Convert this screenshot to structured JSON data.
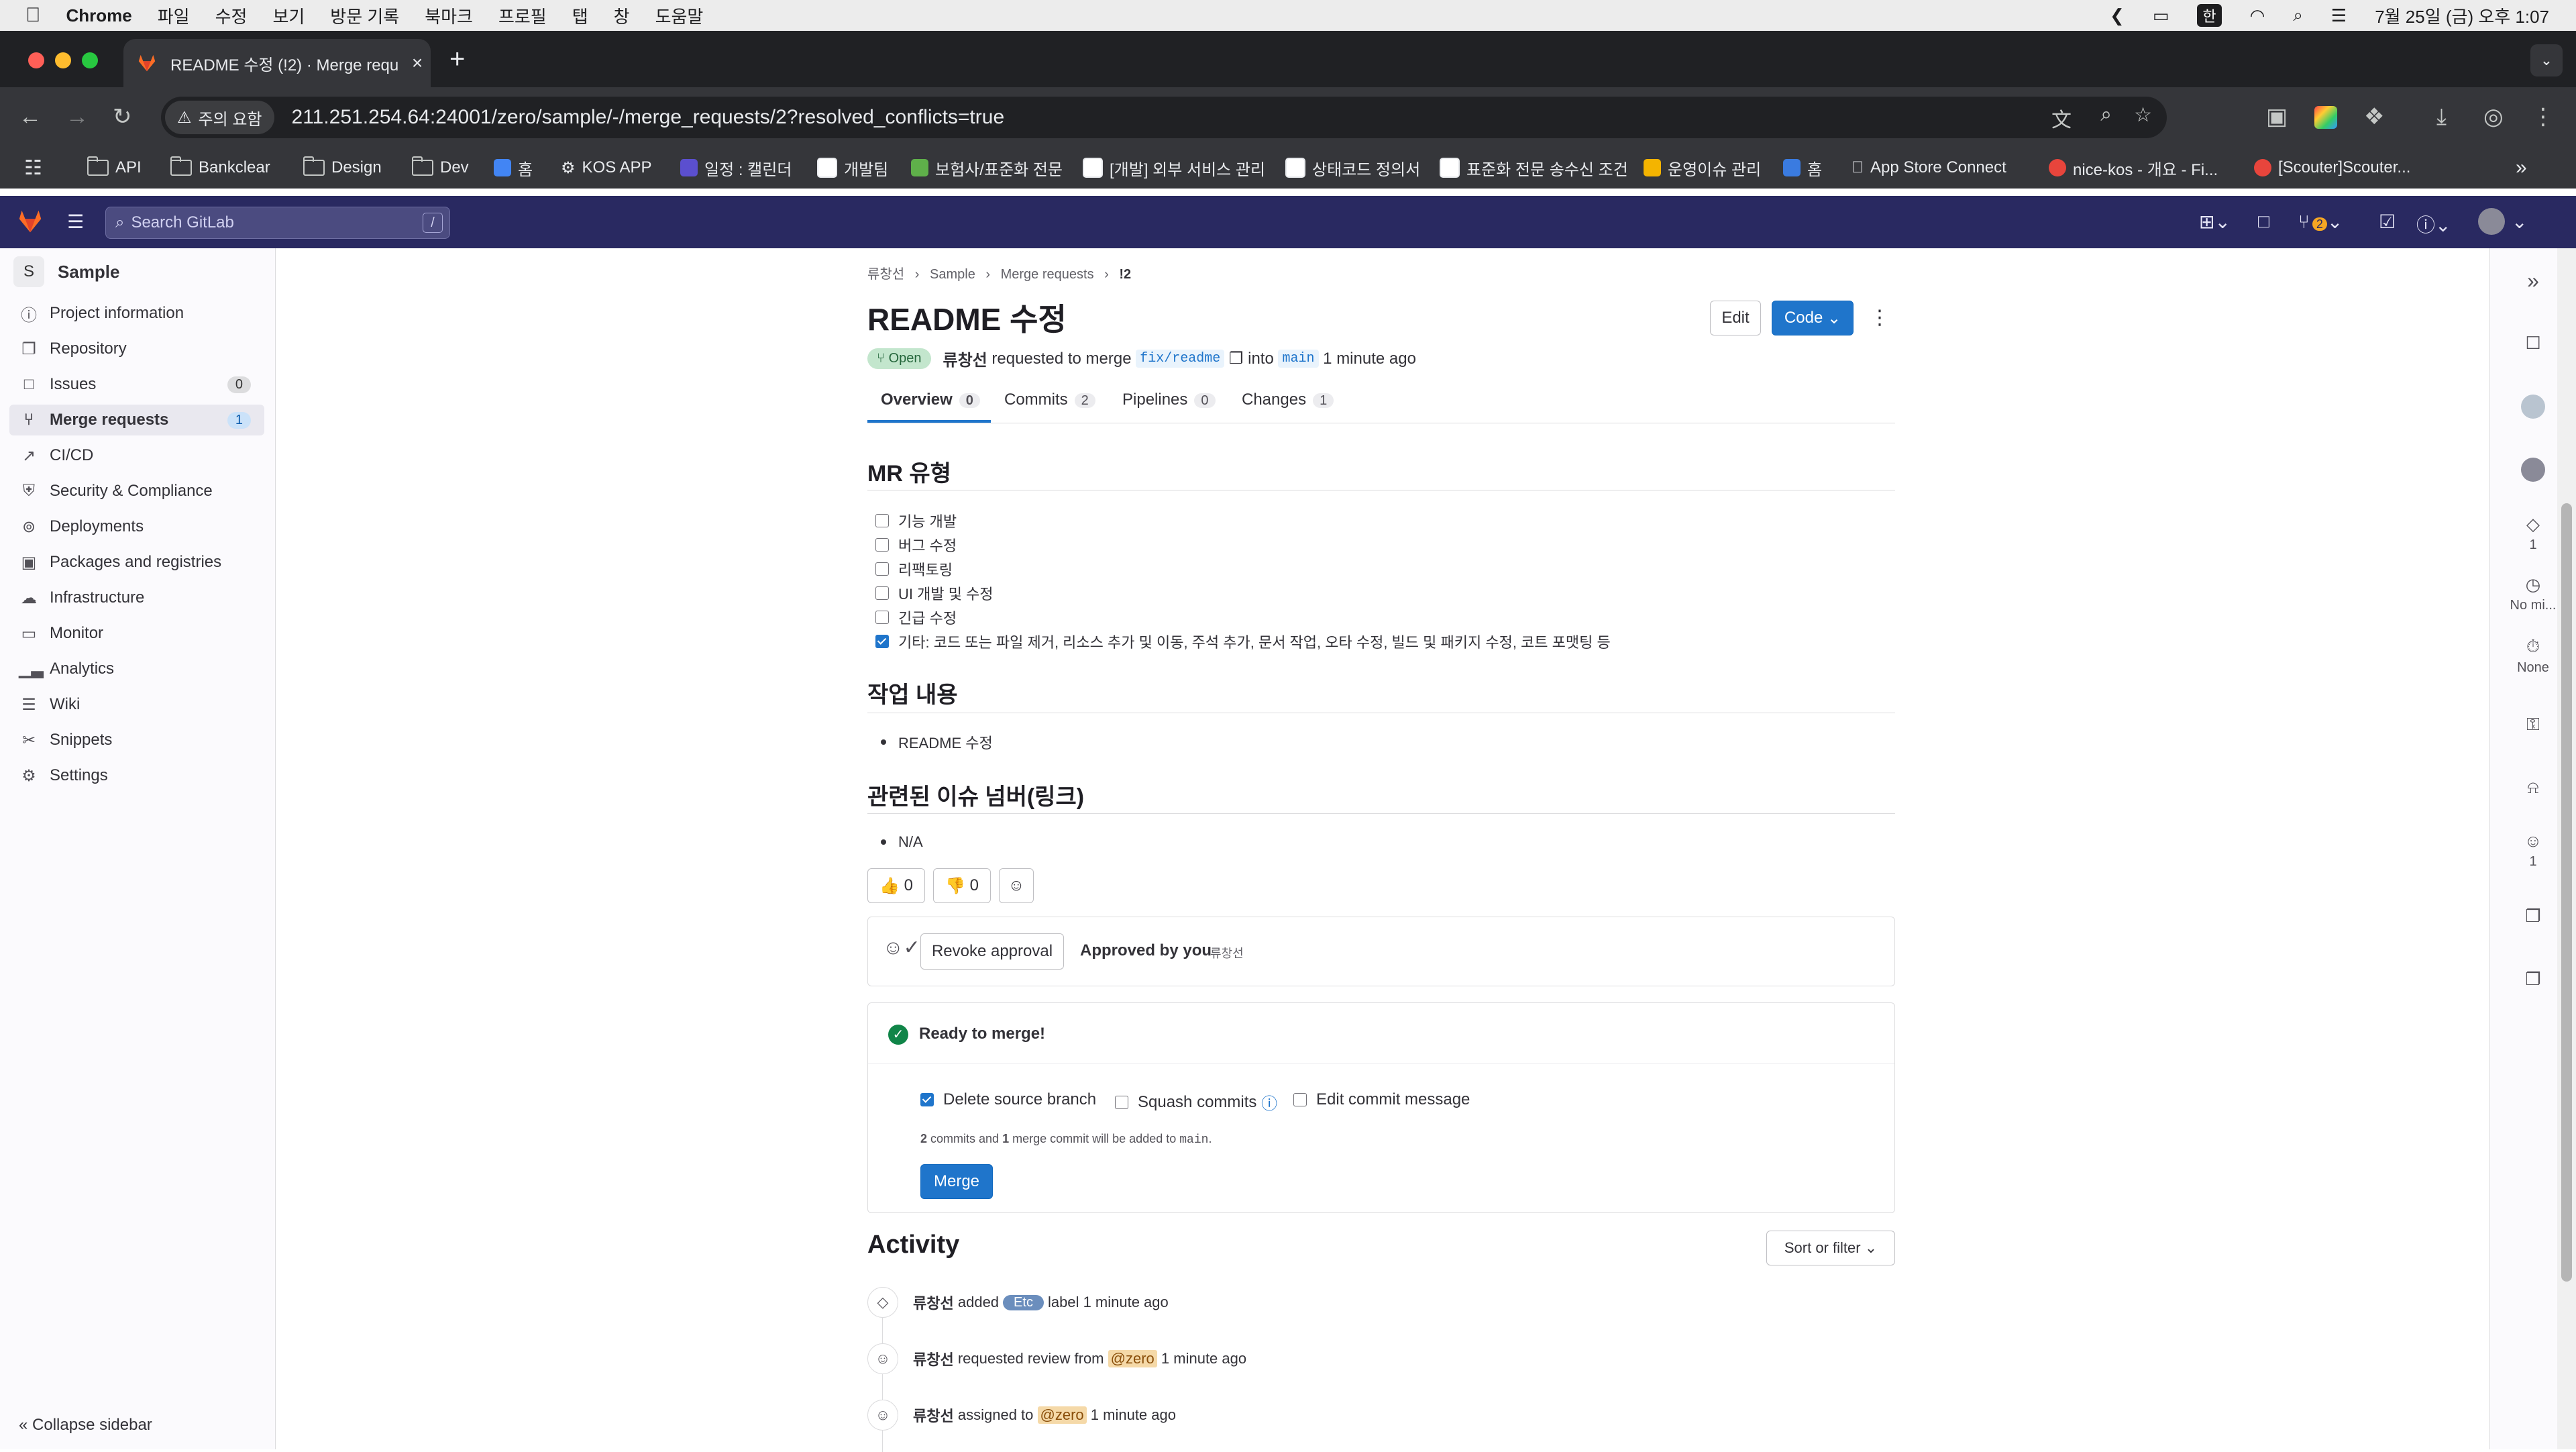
{
  "mac_menu": {
    "app": "Chrome",
    "items": [
      "파일",
      "수정",
      "보기",
      "방문 기록",
      "북마크",
      "프로필",
      "탭",
      "창",
      "도움말"
    ],
    "input_method": "한",
    "clock": "7월 25일 (금) 오후 1:07"
  },
  "browser": {
    "tab_title": "README 수정 (!2) · Merge requ",
    "security_label": "주의 요함",
    "url": "211.251.254.64:24001/zero/sample/-/merge_requests/2?resolved_conflicts=true",
    "bookmarks": [
      "API",
      "Bankclear",
      "Design",
      "Dev",
      "홈",
      "KOS APP",
      "일정 : 캘린더",
      "개발팀",
      "보험사/표준화 전문",
      "[개발] 외부 서비스 관리",
      "상태코드 정의서",
      "표준화 전문 송수신 조건",
      "운영이슈 관리",
      "홈",
      "App Store Connect",
      "nice-kos - 개요 - Fi...",
      "[Scouter]Scouter..."
    ]
  },
  "gitlab": {
    "search_placeholder": "Search GitLab",
    "search_shortcut": "/",
    "todo_count": "2"
  },
  "sidebar": {
    "project_initial": "S",
    "project_name": "Sample",
    "items": [
      {
        "label": "Project information",
        "icon": "info-icon"
      },
      {
        "label": "Repository",
        "icon": "repository-icon"
      },
      {
        "label": "Issues",
        "icon": "issues-icon",
        "count": "0"
      },
      {
        "label": "Merge requests",
        "icon": "merge-request-icon",
        "count": "1"
      },
      {
        "label": "CI/CD",
        "icon": "rocket-icon"
      },
      {
        "label": "Security & Compliance",
        "icon": "shield-icon"
      },
      {
        "label": "Deployments",
        "icon": "deployments-icon"
      },
      {
        "label": "Packages and registries",
        "icon": "package-icon"
      },
      {
        "label": "Infrastructure",
        "icon": "cloud-icon"
      },
      {
        "label": "Monitor",
        "icon": "monitor-icon"
      },
      {
        "label": "Analytics",
        "icon": "chart-icon"
      },
      {
        "label": "Wiki",
        "icon": "book-icon"
      },
      {
        "label": "Snippets",
        "icon": "snippet-icon"
      },
      {
        "label": "Settings",
        "icon": "settings-icon"
      }
    ],
    "collapse_label": "Collapse sidebar"
  },
  "breadcrumb": [
    "류창선",
    "Sample",
    "Merge requests",
    "!2"
  ],
  "mr": {
    "title": "README 수정",
    "edit_label": "Edit",
    "code_label": "Code",
    "state": "Open",
    "author": "류창선",
    "requested_text": "requested to merge",
    "source_branch": "fix/readme",
    "into_text": "into",
    "target_branch": "main",
    "time": "1 minute ago"
  },
  "tabs": [
    {
      "label": "Overview",
      "count": "0"
    },
    {
      "label": "Commits",
      "count": "2"
    },
    {
      "label": "Pipelines",
      "count": "0"
    },
    {
      "label": "Changes",
      "count": "1"
    }
  ],
  "description": {
    "heading_type": "MR 유형",
    "types": [
      {
        "label": "기능 개발",
        "checked": false
      },
      {
        "label": "버그 수정",
        "checked": false
      },
      {
        "label": "리팩토링",
        "checked": false
      },
      {
        "label": "UI 개발 및 수정",
        "checked": false
      },
      {
        "label": "긴급 수정",
        "checked": false
      },
      {
        "label": "기타: 코드 또는 파일 제거, 리소스 추가 및 이동, 주석 추가, 문서 작업, 오타 수정, 빌드 및 패키지 수정, 코트 포맷팅 등",
        "checked": true
      }
    ],
    "heading_work": "작업 내용",
    "work_items": [
      "README 수정"
    ],
    "heading_issue": "관련된 이슈 넘버(링크)",
    "issue_items": [
      "N/A"
    ]
  },
  "reactions": {
    "thumbs_up": "0",
    "thumbs_down": "0"
  },
  "approval": {
    "revoke_label": "Revoke approval",
    "approved_text": "Approved by you",
    "approver_alt": "류창선"
  },
  "merge": {
    "status": "Ready to merge!",
    "delete_source_label": "Delete source branch",
    "squash_label": "Squash commits",
    "edit_message_label": "Edit commit message",
    "summary_commits": "2",
    "summary_mid": "commits and",
    "summary_merge": "1",
    "summary_end": "merge commit will be added to",
    "summary_branch": "main",
    "button_label": "Merge"
  },
  "activity": {
    "heading": "Activity",
    "sort_label": "Sort or filter",
    "events": [
      {
        "user": "류창선",
        "pre": "added",
        "label": "Etc",
        "post": "label",
        "time": "1 minute ago"
      },
      {
        "user": "류창선",
        "pre": "requested review from",
        "mention": "@zero",
        "time": "1 minute ago"
      },
      {
        "user": "류창선",
        "pre": "assigned to",
        "mention": "@zero",
        "time": "1 minute ago"
      }
    ]
  },
  "right_sidebar": {
    "labels_count": "1",
    "milestone": "No mi...",
    "time_tracking": "None",
    "participants_count": "1"
  },
  "colors": {
    "gitlab_nav": "#292961",
    "primary_blue": "#1f75cb",
    "success_green": "#108548"
  }
}
